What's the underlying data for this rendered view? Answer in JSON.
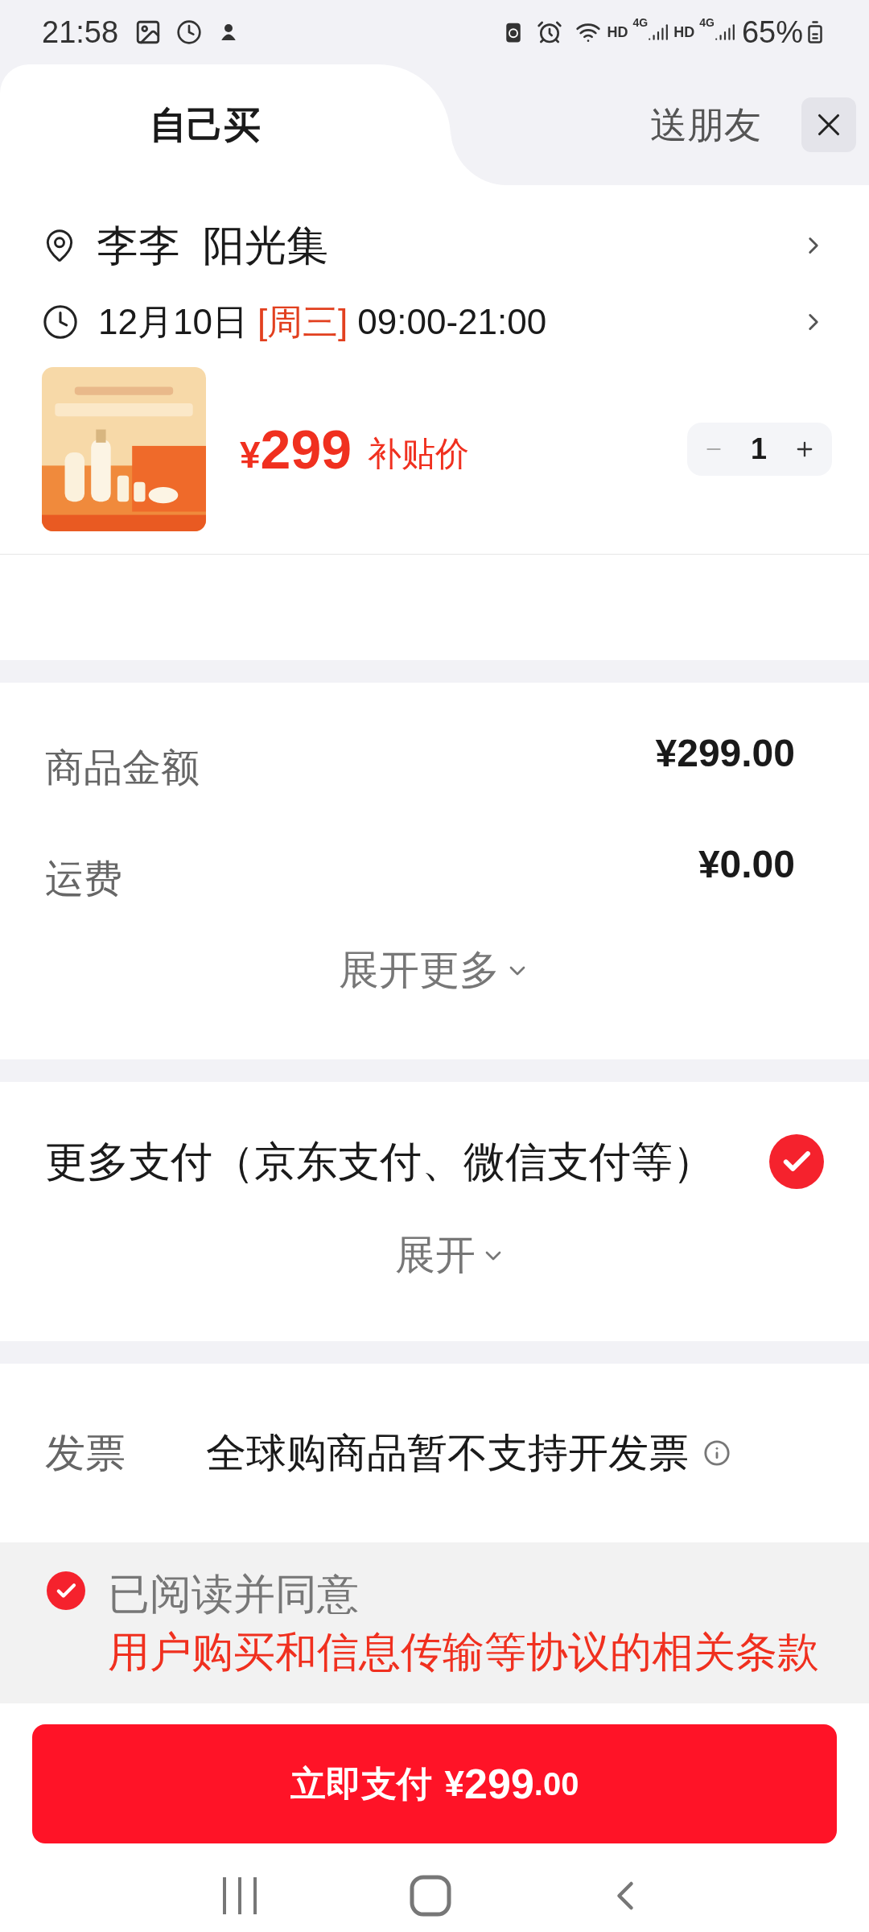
{
  "status_bar": {
    "time": "21:58",
    "network_labels": [
      "HD",
      "4G",
      "HD",
      "4G"
    ],
    "battery": "65%"
  },
  "tabs": [
    {
      "label": "自己买",
      "selected": true
    },
    {
      "label": "送朋友",
      "selected": false
    }
  ],
  "address": {
    "name": "李李",
    "place": "阳光集"
  },
  "delivery": {
    "date": "12月10日",
    "weekday": "[周三]",
    "time": "09:00-21:00"
  },
  "product": {
    "currency": "¥",
    "price": "299",
    "price_label": "补贴价",
    "quantity": "1"
  },
  "summary": {
    "rows": [
      {
        "label": "商品金额",
        "value": "¥299.00"
      },
      {
        "label": "运费",
        "value": "¥0.00"
      }
    ],
    "expand": "展开更多"
  },
  "payment": {
    "label": "更多支付（京东支付、微信支付等）",
    "selected": true,
    "expand": "展开"
  },
  "invoice": {
    "label": "发票",
    "value": "全球购商品暂不支持开发票"
  },
  "agreement": {
    "checked": true,
    "text": "已阅读并同意",
    "link": "用户购买和信息传输等协议的相关条款"
  },
  "pay_button": {
    "label": "立即支付",
    "currency": "¥",
    "amount": "299",
    "decimals": ".00"
  }
}
